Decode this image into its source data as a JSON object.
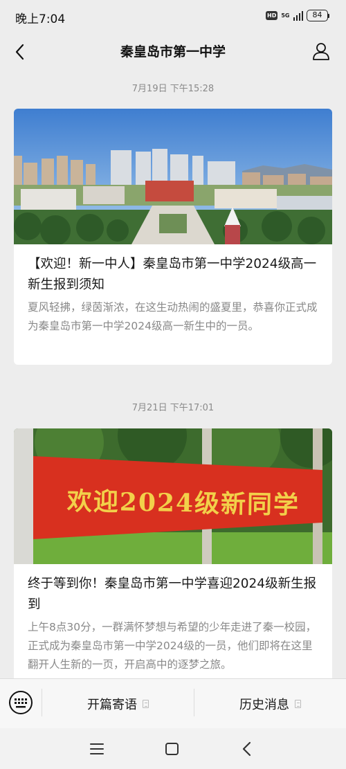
{
  "status_bar": {
    "time": "晚上7:04",
    "hd": "HD",
    "network": "5G",
    "battery": "84"
  },
  "nav": {
    "title": "秦皇岛市第一中学"
  },
  "feed": {
    "posts": [
      {
        "timestamp": "7月19日 下午15:28",
        "title": "【欢迎！新一中人】秦皇岛市第一中学2024级高一新生报到须知",
        "summary": "夏风轻拂，绿茵渐浓，在这生动热闹的盛夏里，恭喜你正式成为秦皇岛市第一中学2024级高一新生中的一员。"
      },
      {
        "timestamp": "7月21日 下午17:01",
        "banner_text": "欢迎2024级新同学",
        "title": "终于等到你！秦皇岛市第一中学喜迎2024级新生报到",
        "summary": "上午8点30分，一群满怀梦想与希望的少年走进了秦一校园，正式成为秦皇岛市第一中学2024级的一员，他们即将在这里翻开人生新的一页，开启高中的逐梦之旅。"
      }
    ]
  },
  "bottom_menu": {
    "items": [
      {
        "label": "开篇寄语"
      },
      {
        "label": "历史消息"
      }
    ]
  },
  "colors": {
    "background": "#ededed",
    "card": "#ffffff",
    "banner_red": "#d8301f",
    "banner_text": "#f2d04a"
  }
}
